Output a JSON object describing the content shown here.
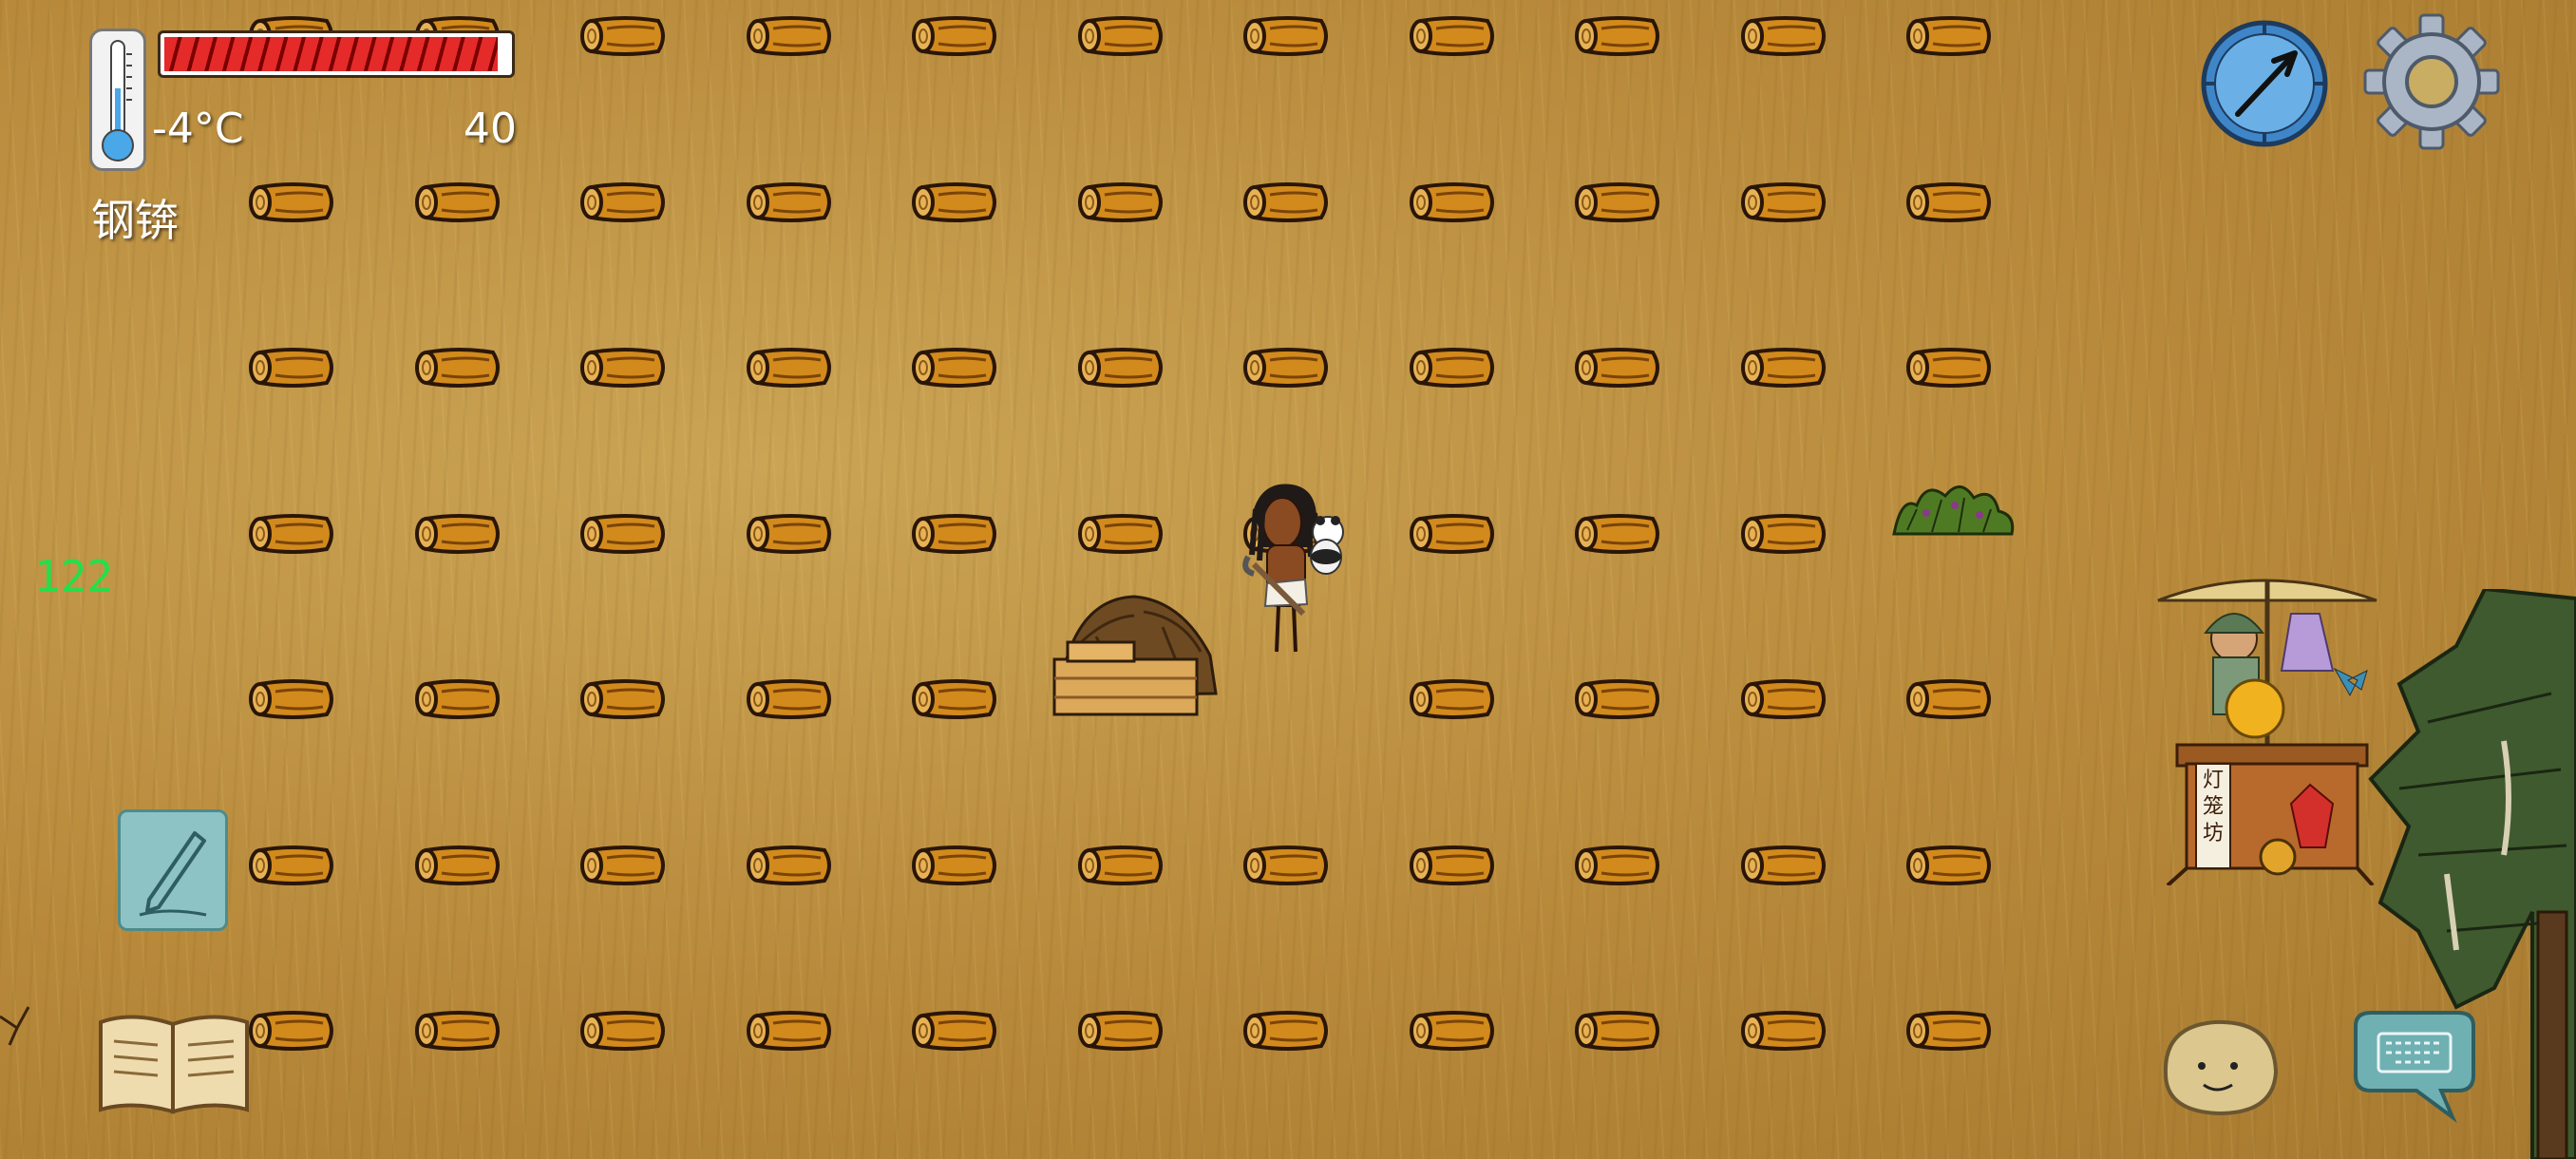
{
  "hud": {
    "temperature": "-4°C",
    "food_count": "40",
    "held_item": "钢锛",
    "fps": "122",
    "food_bar_level": 0.97
  },
  "world": {
    "log_rows": 7,
    "log_cols": 11,
    "missing_logs": [
      [
        3,
        10
      ],
      [
        4,
        5
      ],
      [
        4,
        6
      ]
    ]
  },
  "stall": {
    "sign_text": "灯笼坊"
  },
  "icons": {
    "thermometer": "thermometer-icon",
    "compass": "compass-icon",
    "settings": "gear-icon",
    "write": "pencil-icon",
    "recipe_book": "book-icon",
    "emote": "emote-face-icon",
    "keyboard": "keyboard-icon"
  },
  "colors": {
    "fps_green": "#22e04a",
    "food_red": "#e52a2a",
    "button_teal": "#8dc3c4",
    "compass_blue": "#3f86c9"
  }
}
